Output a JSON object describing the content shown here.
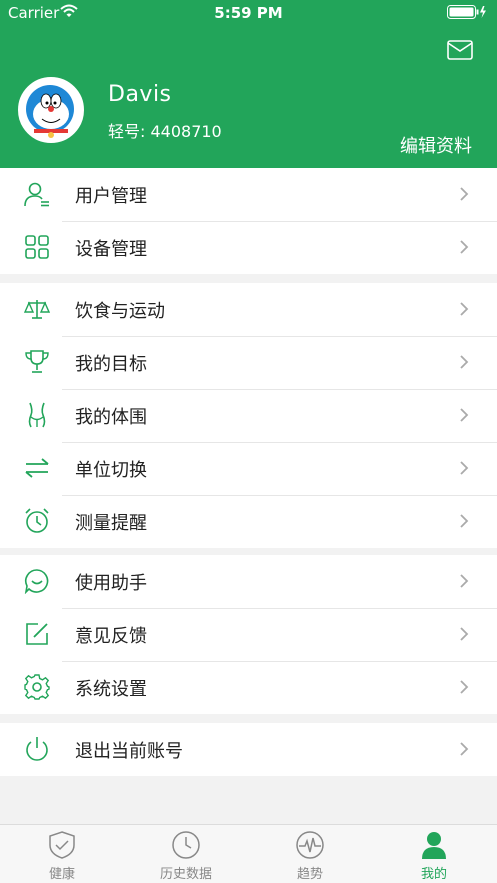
{
  "status_bar": {
    "carrier": "Carrier",
    "time": "5:59 PM"
  },
  "profile": {
    "name": "Davis",
    "id_text": "轻号: 4408710",
    "edit_label": "编辑资料"
  },
  "menu_groups": [
    {
      "items": [
        {
          "label": "用户管理",
          "icon": "user-manage-icon"
        },
        {
          "label": "设备管理",
          "icon": "device-grid-icon"
        }
      ]
    },
    {
      "items": [
        {
          "label": "饮食与运动",
          "icon": "scale-balance-icon"
        },
        {
          "label": "我的目标",
          "icon": "trophy-icon"
        },
        {
          "label": "我的体围",
          "icon": "body-figure-icon"
        },
        {
          "label": "单位切换",
          "icon": "swap-arrows-icon"
        },
        {
          "label": "测量提醒",
          "icon": "alarm-clock-icon"
        }
      ]
    },
    {
      "items": [
        {
          "label": "使用助手",
          "icon": "chat-bubble-icon"
        },
        {
          "label": "意见反馈",
          "icon": "edit-square-icon"
        },
        {
          "label": "系统设置",
          "icon": "gear-icon"
        }
      ]
    },
    {
      "items": [
        {
          "label": "退出当前账号",
          "icon": "power-icon"
        }
      ]
    }
  ],
  "tabs": [
    {
      "label": "健康",
      "icon": "shield-check-icon",
      "active": false
    },
    {
      "label": "历史数据",
      "icon": "clock-icon",
      "active": false
    },
    {
      "label": "趋势",
      "icon": "pulse-icon",
      "active": false
    },
    {
      "label": "我的",
      "icon": "person-icon",
      "active": true
    }
  ],
  "colors": {
    "brand": "#22a55a",
    "background": "#f2f2f2",
    "inactive": "#888888"
  }
}
